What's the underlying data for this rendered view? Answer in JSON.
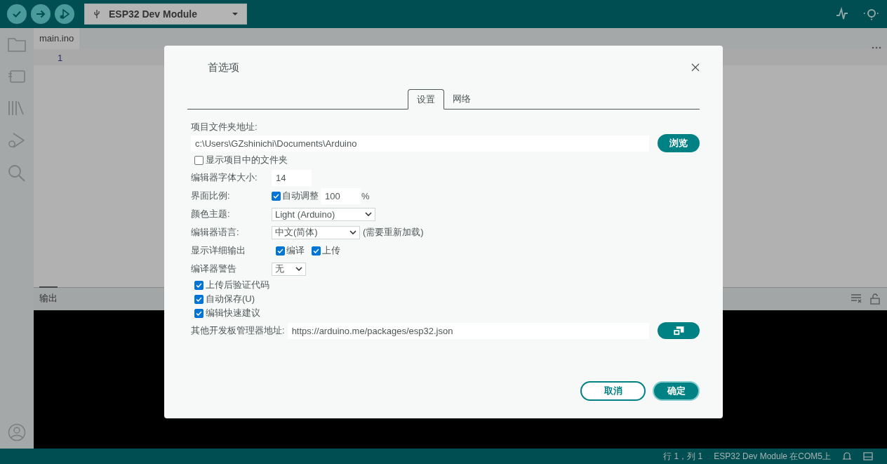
{
  "toolbar": {
    "board": "ESP32 Dev Module"
  },
  "editor": {
    "tab": "main.ino",
    "line_numbers": [
      "1"
    ]
  },
  "output_panel": {
    "title": "输出"
  },
  "status_bar": {
    "position": "行 1，列 1",
    "board": "ESP32 Dev Module 在COM5上"
  },
  "dialog": {
    "title": "首选项",
    "tabs": [
      {
        "label": "设置",
        "selected": true
      },
      {
        "label": "网络",
        "selected": false
      }
    ],
    "rows": [
      {
        "kind": "path",
        "label": "项目文件夹地址:",
        "value": "c:\\Users\\GZshinichi\\Documents\\Arduino",
        "button": "浏览"
      },
      {
        "kind": "check",
        "label": "显示项目中的文件夹",
        "checked": false
      },
      {
        "kind": "text",
        "label": "编辑器字体大小:",
        "value": "14"
      },
      {
        "kind": "scale",
        "label": "界面比例:",
        "check_label": "自动调整",
        "checked": true,
        "value": "100",
        "unit": "%"
      },
      {
        "kind": "select",
        "label": "颜色主题:",
        "value": "Light (Arduino)"
      },
      {
        "kind": "select",
        "label": "编辑器语言:",
        "value": "中文(简体)",
        "note": "(需要重新加载)"
      },
      {
        "kind": "checks",
        "label": "显示详细输出",
        "options": [
          {
            "label": "编译",
            "checked": true
          },
          {
            "label": "上传",
            "checked": true
          }
        ]
      },
      {
        "kind": "select",
        "label": "编译器警告",
        "value": "无"
      },
      {
        "kind": "check",
        "label": "上传后验证代码",
        "checked": true
      },
      {
        "kind": "check",
        "label": "自动保存(U)",
        "checked": true
      },
      {
        "kind": "check",
        "label": "编辑快速建议",
        "checked": true
      },
      {
        "kind": "url",
        "label": "其他开发板管理器地址:",
        "value": "https://arduino.me/packages/esp32.json"
      }
    ],
    "buttons": [
      {
        "label": "取消",
        "kind": "secondary"
      },
      {
        "label": "确定",
        "kind": "primary"
      }
    ]
  }
}
